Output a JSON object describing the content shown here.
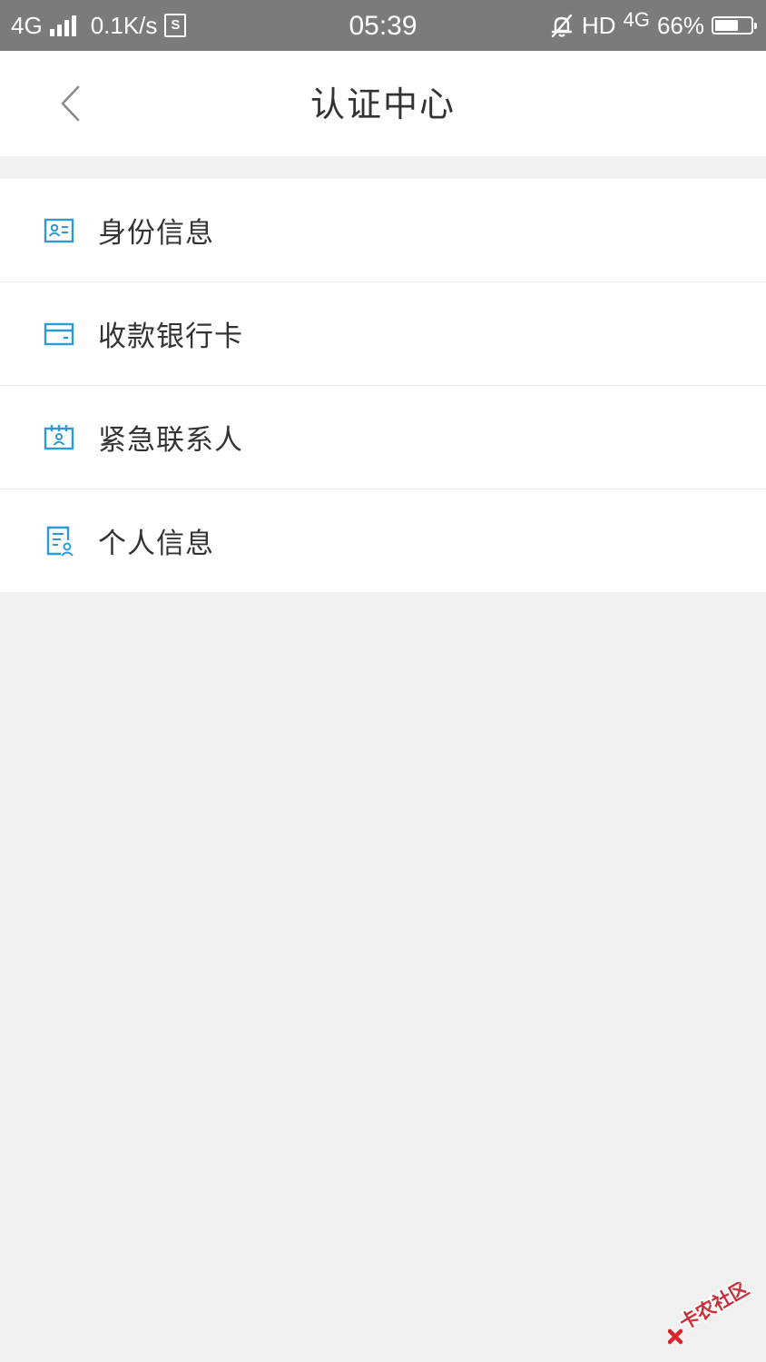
{
  "status_bar": {
    "network": "4G",
    "speed": "0.1K/s",
    "sim_label": "S",
    "time": "05:39",
    "hd": "HD",
    "network_right": "4G",
    "battery": "66%",
    "battery_level": 0.66
  },
  "nav": {
    "title": "认证中心",
    "back_icon": "chevron-left-icon"
  },
  "menu": {
    "items": [
      {
        "label": "身份信息",
        "icon": "id-card-icon"
      },
      {
        "label": "收款银行卡",
        "icon": "bank-card-icon"
      },
      {
        "label": "紧急联系人",
        "icon": "contact-card-icon"
      },
      {
        "label": "个人信息",
        "icon": "personal-document-icon"
      }
    ]
  },
  "watermark": {
    "text": "卡农社区"
  },
  "colors": {
    "accent": "#2d9ad8",
    "background": "#f1f0f1",
    "status_bar": "#7b7b7b",
    "text": "#333333",
    "watermark": "#e0303a"
  }
}
